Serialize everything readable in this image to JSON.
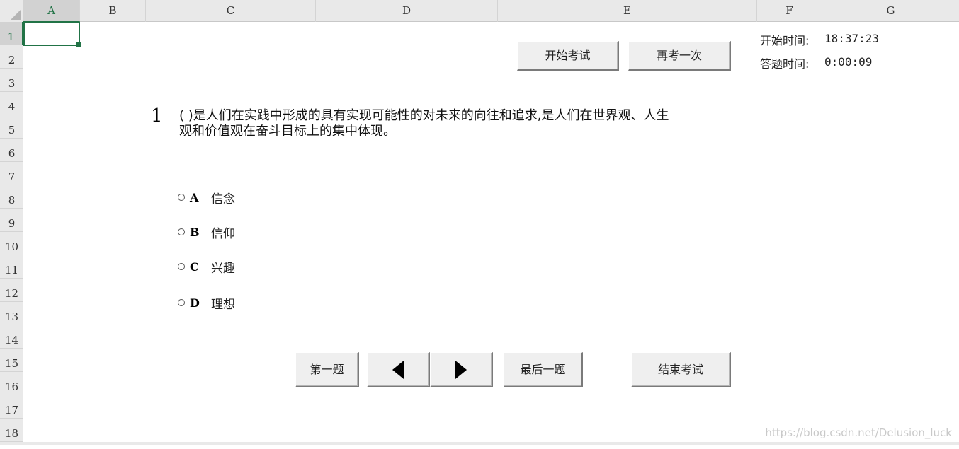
{
  "columns": [
    "A",
    "B",
    "C",
    "D",
    "E",
    "F",
    "G"
  ],
  "rows": [
    "1",
    "2",
    "3",
    "4",
    "5",
    "6",
    "7",
    "8",
    "9",
    "10",
    "11",
    "12",
    "13",
    "14",
    "15",
    "16",
    "17",
    "18"
  ],
  "buttons": {
    "start_exam": "开始考试",
    "retake": "再考一次",
    "first_question": "第一题",
    "last_question": "最后一题",
    "end_exam": "结束考试"
  },
  "timers": {
    "start_label": "开始时间:",
    "start_value": "18:37:23",
    "elapsed_label": "答题时间:",
    "elapsed_value": "0:00:09"
  },
  "question": {
    "number": "1",
    "line1": "( )是人们在实践中形成的具有实现可能性的对未来的向往和追求,是人们在世界观、人生",
    "line2": "观和价值观在奋斗目标上的集中体现。"
  },
  "options": [
    {
      "letter": "A",
      "text": "信念"
    },
    {
      "letter": "B",
      "text": "信仰"
    },
    {
      "letter": "C",
      "text": "兴趣"
    },
    {
      "letter": "D",
      "text": "理想"
    }
  ],
  "watermark": "https://blog.csdn.net/Delusion_luck"
}
